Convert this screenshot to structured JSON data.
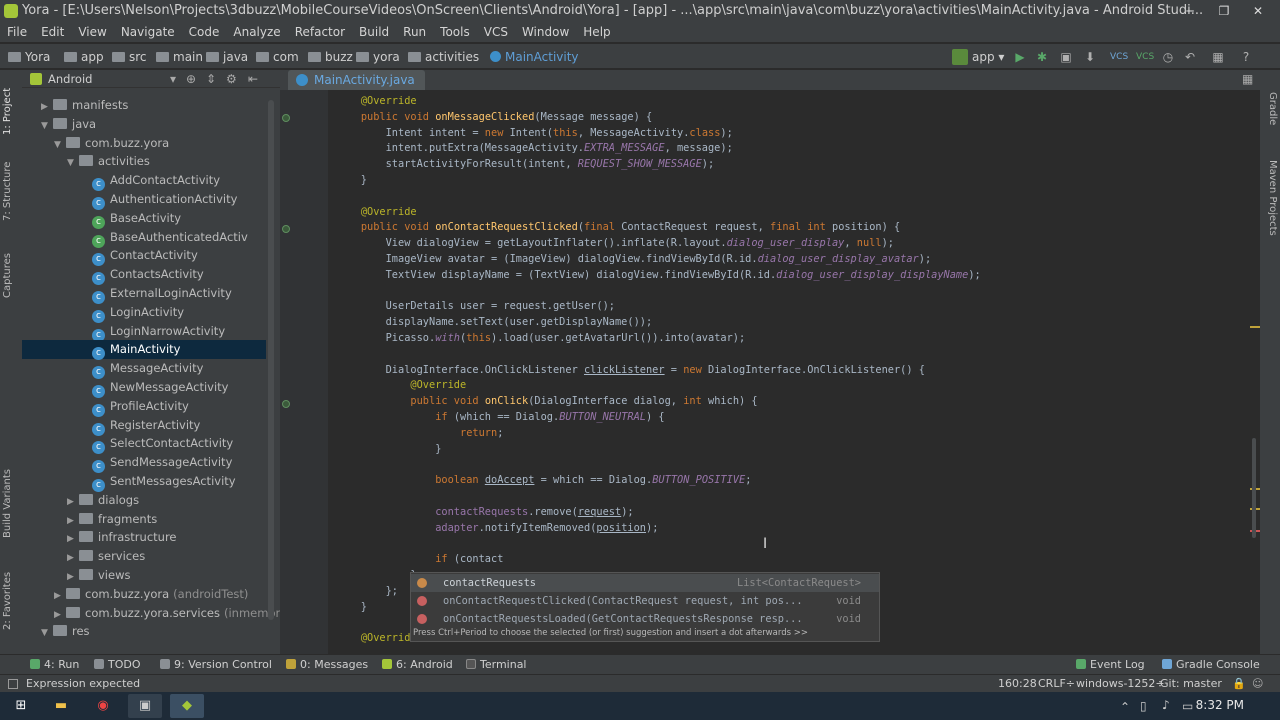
{
  "window": {
    "title": "Yora - [E:\\Users\\Nelson\\Projects\\3dbuzz\\MobileCourseVideos\\OnScreen\\Clients\\Android\\Yora] - [app] - ...\\app\\src\\main\\java\\com\\buzz\\yora\\activities\\MainActivity.java - Android Studi..."
  },
  "menu": [
    "File",
    "Edit",
    "View",
    "Navigate",
    "Code",
    "Analyze",
    "Refactor",
    "Build",
    "Run",
    "Tools",
    "VCS",
    "Window",
    "Help"
  ],
  "breadcrumbs": [
    "Yora",
    "app",
    "src",
    "main",
    "java",
    "com",
    "buzz",
    "yora",
    "activities",
    "MainActivity"
  ],
  "toolbar": {
    "run_config": "app"
  },
  "project": {
    "view_selector": "Android",
    "tree": [
      {
        "label": "manifests",
        "indent": 1,
        "arrow": "▶",
        "icon": "folder"
      },
      {
        "label": "java",
        "indent": 1,
        "arrow": "▼",
        "icon": "folder"
      },
      {
        "label": "com.buzz.yora",
        "indent": 2,
        "arrow": "▼",
        "icon": "folder"
      },
      {
        "label": "activities",
        "indent": 3,
        "arrow": "▼",
        "icon": "folder"
      },
      {
        "label": "AddContactActivity",
        "indent": 4,
        "icon": "class"
      },
      {
        "label": "AuthenticationActivity",
        "indent": 4,
        "icon": "class"
      },
      {
        "label": "BaseActivity",
        "indent": 4,
        "icon": "abstract"
      },
      {
        "label": "BaseAuthenticatedActiv",
        "indent": 4,
        "icon": "abstract"
      },
      {
        "label": "ContactActivity",
        "indent": 4,
        "icon": "class"
      },
      {
        "label": "ContactsActivity",
        "indent": 4,
        "icon": "class"
      },
      {
        "label": "ExternalLoginActivity",
        "indent": 4,
        "icon": "class"
      },
      {
        "label": "LoginActivity",
        "indent": 4,
        "icon": "class"
      },
      {
        "label": "LoginNarrowActivity",
        "indent": 4,
        "icon": "class"
      },
      {
        "label": "MainActivity",
        "indent": 4,
        "icon": "class",
        "selected": true
      },
      {
        "label": "MessageActivity",
        "indent": 4,
        "icon": "class"
      },
      {
        "label": "NewMessageActivity",
        "indent": 4,
        "icon": "class"
      },
      {
        "label": "ProfileActivity",
        "indent": 4,
        "icon": "class"
      },
      {
        "label": "RegisterActivity",
        "indent": 4,
        "icon": "class"
      },
      {
        "label": "SelectContactActivity",
        "indent": 4,
        "icon": "class"
      },
      {
        "label": "SendMessageActivity",
        "indent": 4,
        "icon": "class"
      },
      {
        "label": "SentMessagesActivity",
        "indent": 4,
        "icon": "class"
      },
      {
        "label": "dialogs",
        "indent": 3,
        "arrow": "▶",
        "icon": "folder"
      },
      {
        "label": "fragments",
        "indent": 3,
        "arrow": "▶",
        "icon": "folder"
      },
      {
        "label": "infrastructure",
        "indent": 3,
        "arrow": "▶",
        "icon": "folder"
      },
      {
        "label": "services",
        "indent": 3,
        "arrow": "▶",
        "icon": "folder"
      },
      {
        "label": "views",
        "indent": 3,
        "arrow": "▶",
        "icon": "folder"
      },
      {
        "label": "com.buzz.yora",
        "suffix": "(androidTest)",
        "indent": 2,
        "arrow": "▶",
        "icon": "folder"
      },
      {
        "label": "com.buzz.yora.services",
        "suffix": "(inmemory",
        "indent": 2,
        "arrow": "▶",
        "icon": "folder"
      },
      {
        "label": "res",
        "indent": 1,
        "arrow": "▼",
        "icon": "folder"
      }
    ]
  },
  "editor": {
    "tab": "MainActivity.java",
    "lines": [
      [
        {
          "t": "    "
        },
        {
          "t": "@Override",
          "c": "an"
        }
      ],
      [
        {
          "t": "    "
        },
        {
          "t": "public void ",
          "c": "kw"
        },
        {
          "t": "onMessageClicked",
          "c": "fn"
        },
        {
          "t": "(Message message) {"
        }
      ],
      [
        {
          "t": "        Intent intent = "
        },
        {
          "t": "new ",
          "c": "kw"
        },
        {
          "t": "Intent("
        },
        {
          "t": "this",
          "c": "kw"
        },
        {
          "t": ", MessageActivity."
        },
        {
          "t": "class",
          "c": "kw"
        },
        {
          "t": ");"
        }
      ],
      [
        {
          "t": "        intent.putExtra(MessageActivity."
        },
        {
          "t": "EXTRA_MESSAGE",
          "c": "it"
        },
        {
          "t": ", message);"
        }
      ],
      [
        {
          "t": "        startActivityForResult(intent, "
        },
        {
          "t": "REQUEST_SHOW_MESSAGE",
          "c": "it"
        },
        {
          "t": ");"
        }
      ],
      [
        {
          "t": "    }"
        }
      ],
      [
        {
          "t": ""
        }
      ],
      [
        {
          "t": "    "
        },
        {
          "t": "@Override",
          "c": "an"
        }
      ],
      [
        {
          "t": "    "
        },
        {
          "t": "public void ",
          "c": "kw"
        },
        {
          "t": "onContactRequestClicked",
          "c": "fn"
        },
        {
          "t": "("
        },
        {
          "t": "final ",
          "c": "kw"
        },
        {
          "t": "ContactRequest request, "
        },
        {
          "t": "final int ",
          "c": "kw"
        },
        {
          "t": "position) {"
        }
      ],
      [
        {
          "t": "        View dialogView = getLayoutInflater().inflate(R.layout."
        },
        {
          "t": "dialog_user_display",
          "c": "it"
        },
        {
          "t": ", "
        },
        {
          "t": "null",
          "c": "kw"
        },
        {
          "t": ");"
        }
      ],
      [
        {
          "t": "        ImageView avatar = (ImageView) dialogView.findViewById(R.id."
        },
        {
          "t": "dialog_user_display_avatar",
          "c": "it"
        },
        {
          "t": ");"
        }
      ],
      [
        {
          "t": "        TextView displayName = (TextView) dialogView.findViewById(R.id."
        },
        {
          "t": "dialog_user_display_displayName",
          "c": "it"
        },
        {
          "t": ");"
        }
      ],
      [
        {
          "t": ""
        }
      ],
      [
        {
          "t": "        UserDetails user = request.getUser();"
        }
      ],
      [
        {
          "t": "        displayName.setText(user.getDisplayName());"
        }
      ],
      [
        {
          "t": "        Picasso."
        },
        {
          "t": "with",
          "c": "it"
        },
        {
          "t": "("
        },
        {
          "t": "this",
          "c": "kw"
        },
        {
          "t": ").load(user.getAvatarUrl()).into(avatar);"
        }
      ],
      [
        {
          "t": ""
        }
      ],
      [
        {
          "t": "        DialogInterface.OnClickListener "
        },
        {
          "t": "clickListener",
          "c": "un"
        },
        {
          "t": " = "
        },
        {
          "t": "new ",
          "c": "kw"
        },
        {
          "t": "DialogInterface.OnClickListener() {"
        }
      ],
      [
        {
          "t": "            "
        },
        {
          "t": "@Override",
          "c": "an"
        }
      ],
      [
        {
          "t": "            "
        },
        {
          "t": "public void ",
          "c": "kw"
        },
        {
          "t": "onClick",
          "c": "fn"
        },
        {
          "t": "(DialogInterface dialog, "
        },
        {
          "t": "int ",
          "c": "kw"
        },
        {
          "t": "which) {"
        }
      ],
      [
        {
          "t": "                "
        },
        {
          "t": "if ",
          "c": "kw"
        },
        {
          "t": "(which == Dialog."
        },
        {
          "t": "BUTTON_NEUTRAL",
          "c": "it"
        },
        {
          "t": ") {"
        }
      ],
      [
        {
          "t": "                    "
        },
        {
          "t": "return",
          "c": "kw"
        },
        {
          "t": ";"
        }
      ],
      [
        {
          "t": "                }"
        }
      ],
      [
        {
          "t": ""
        }
      ],
      [
        {
          "t": "                "
        },
        {
          "t": "boolean ",
          "c": "kw"
        },
        {
          "t": "doAccept",
          "c": "un"
        },
        {
          "t": " = which == Dialog."
        },
        {
          "t": "BUTTON_POSITIVE",
          "c": "it"
        },
        {
          "t": ";"
        }
      ],
      [
        {
          "t": ""
        }
      ],
      [
        {
          "t": "                "
        },
        {
          "t": "contactRequests",
          "c": "pf"
        },
        {
          "t": ".remove("
        },
        {
          "t": "request",
          "c": "un"
        },
        {
          "t": ");"
        }
      ],
      [
        {
          "t": "                "
        },
        {
          "t": "adapter",
          "c": "pf"
        },
        {
          "t": ".notifyItemRemoved("
        },
        {
          "t": "position",
          "c": "un"
        },
        {
          "t": ");"
        }
      ],
      [
        {
          "t": ""
        }
      ],
      [
        {
          "t": "                "
        },
        {
          "t": "if ",
          "c": "kw"
        },
        {
          "t": "(contact"
        }
      ],
      [
        {
          "t": "            }"
        }
      ],
      [
        {
          "t": "        }"
        },
        {
          "t": ";"
        }
      ],
      [
        {
          "t": "    }"
        }
      ],
      [
        {
          "t": ""
        }
      ],
      [
        {
          "t": "    "
        },
        {
          "t": "@Override",
          "c": "an"
        }
      ]
    ]
  },
  "completion": {
    "items": [
      {
        "name": "contactRequests",
        "sig": "",
        "type": "List<ContactRequest>",
        "selected": true
      },
      {
        "name": "onContactRequestClicked",
        "sig": "(ContactRequest request, int pos...",
        "type": "void"
      },
      {
        "name": "onContactRequestsLoaded",
        "sig": "(GetContactRequestsResponse resp...",
        "type": "void"
      }
    ],
    "hint": "Press Ctrl+Period to choose the selected (or first) suggestion and insert a dot afterwards  >>"
  },
  "bottom_tools": [
    "4: Run",
    "TODO",
    "9: Version Control",
    "0: Messages",
    "6: Android",
    "Terminal",
    "Event Log",
    "Gradle Console"
  ],
  "status": {
    "message": "Expression expected",
    "position": "160:28",
    "line_sep": "CRLF÷",
    "encoding": "windows-1252÷",
    "vcs": "Git: master"
  },
  "right_tabs": [
    "Gradle",
    "Maven Projects"
  ],
  "left_tabs": [
    "1: Project",
    "7: Structure",
    "Captures",
    "Build Variants",
    "2: Favorites"
  ],
  "taskbar": {
    "time": "8:32 PM"
  },
  "colors": {
    "accent": "#5f9ed6",
    "keyword": "#cc7832",
    "annotation": "#bbb529",
    "method": "#ffc66d",
    "field": "#9876aa"
  }
}
